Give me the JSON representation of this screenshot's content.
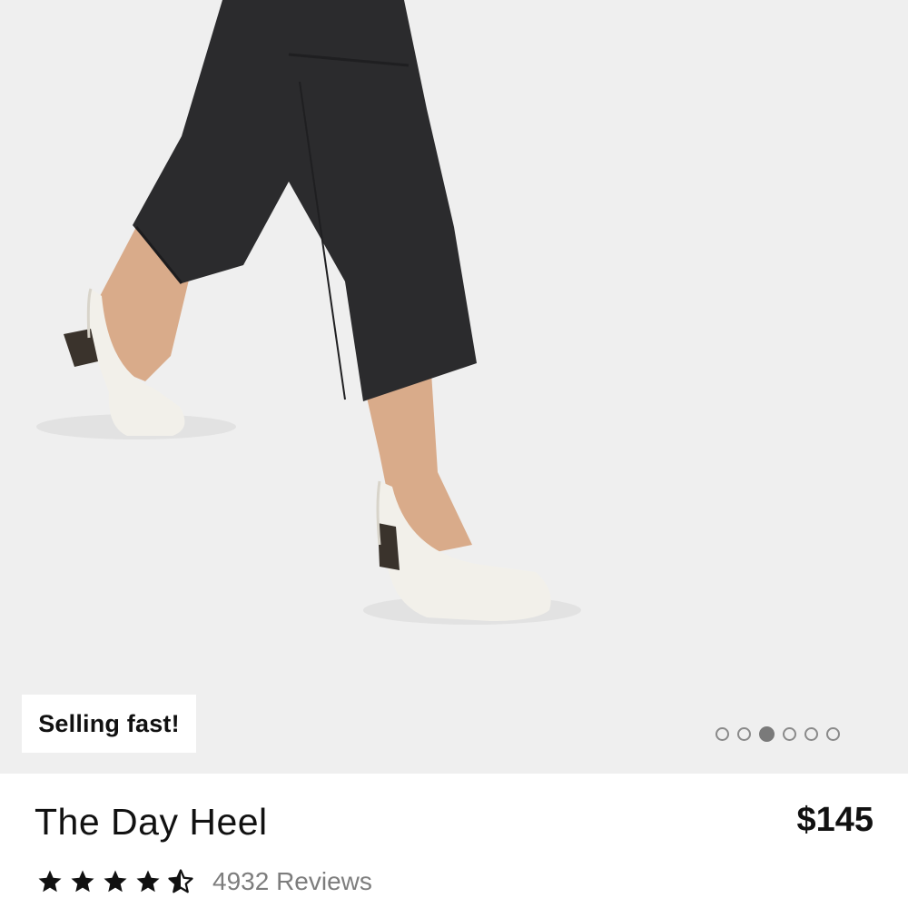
{
  "hero": {
    "badge_text": "Selling fast!",
    "image_count": 6,
    "active_image": 3,
    "background_color": "#efefef"
  },
  "product": {
    "title": "The Day Heel",
    "price": "$145",
    "rating": 4.5,
    "rating_max": 5,
    "reviews_text": "4932 Reviews"
  },
  "colors": {
    "text": "#111111",
    "muted": "#7d7d7d",
    "pants": "#2b2b2d",
    "shoe": "#f2f0ea",
    "heel": "#3a332c"
  }
}
